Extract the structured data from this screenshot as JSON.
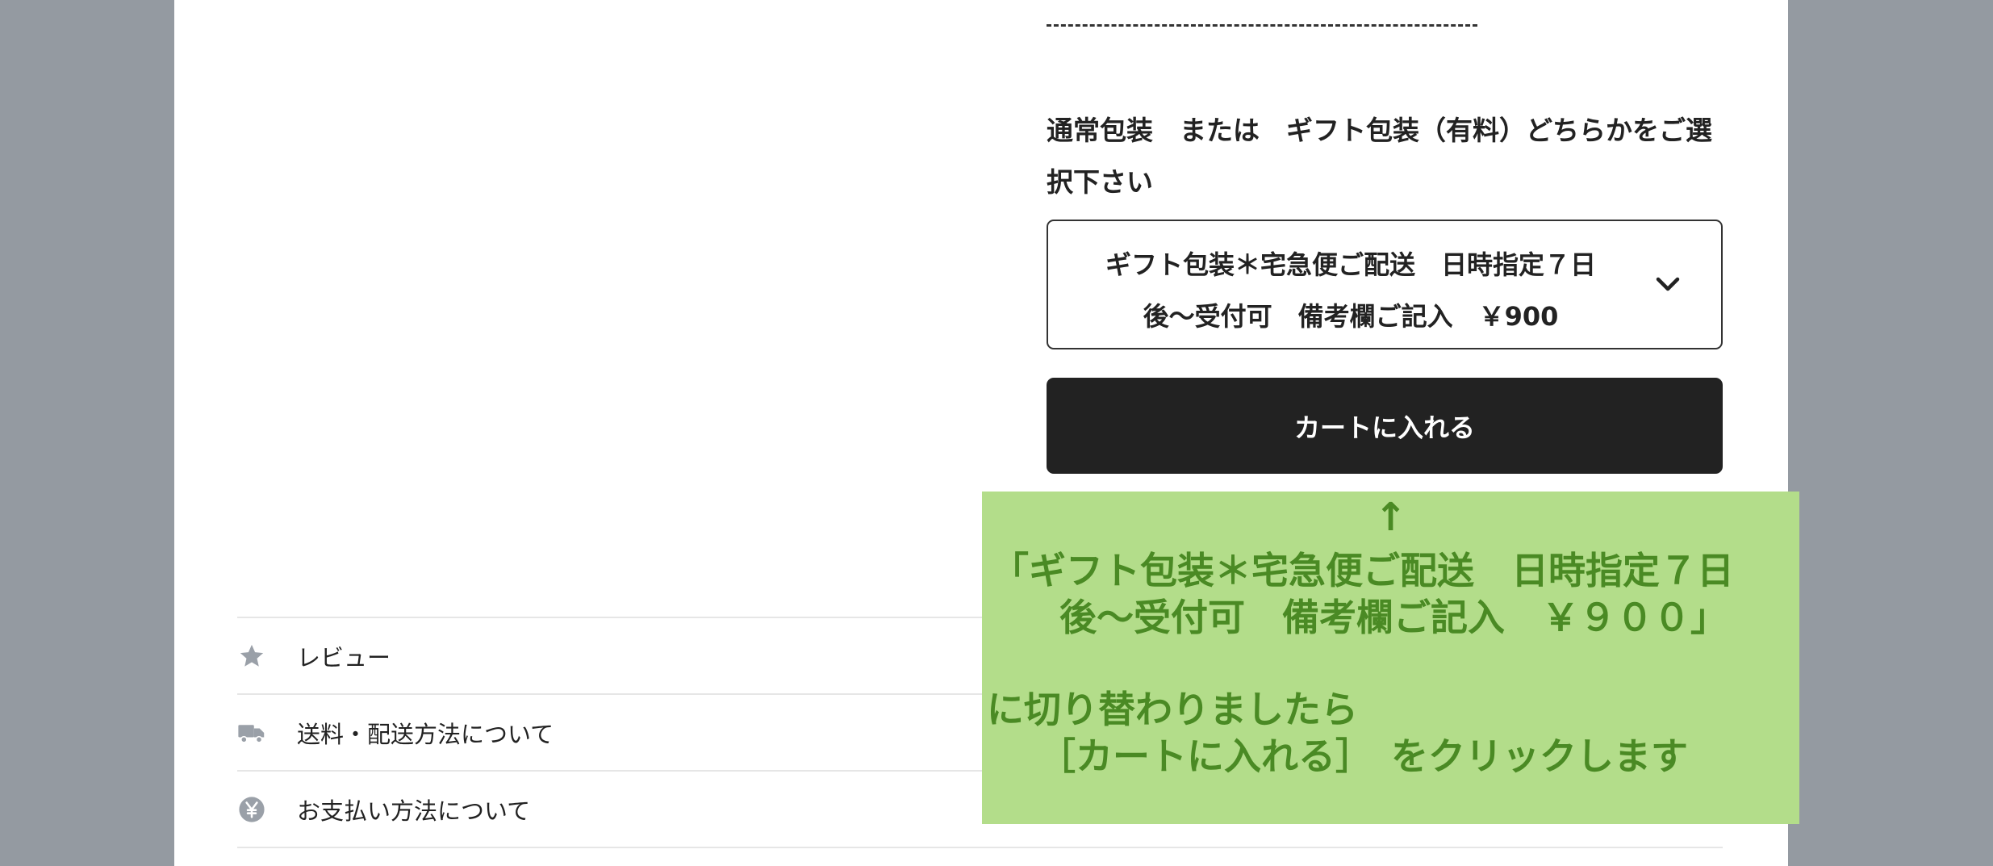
{
  "product_options": {
    "divider_text": "",
    "prompt": "通常包装　または　ギフト包装（有料）どちらかをご選択下さい",
    "select_value_line1": "ギフト包装＊宅急便ご配送　日時指定７日",
    "select_value_line2": "後～受付可　備考欄ご記入　￥900",
    "chevron_icon": "chevron-down-icon",
    "cart_button_label": "カートに入れる"
  },
  "info_links": [
    {
      "icon": "star-icon",
      "label": "レビュー"
    },
    {
      "icon": "truck-icon",
      "label": "送料・配送方法について"
    },
    {
      "icon": "yen-icon",
      "label": "お支払い方法について"
    }
  ],
  "annotation": {
    "arrow": "↑",
    "line1": "「ギフト包装＊宅急便ご配送　日時指定７日",
    "line2": "後～受付可　備考欄ご記入　￥９００」",
    "line3": "に切り替わりましたら",
    "line4": "［カートに入れる］　をクリックします",
    "background_color": "#b3dd8a",
    "text_color": "#4a8a24"
  },
  "colors": {
    "page_background": "#949aa1",
    "panel_background": "#ffffff",
    "button_background": "#222222",
    "button_text": "#ffffff",
    "icon_color": "#9aa0a8"
  }
}
